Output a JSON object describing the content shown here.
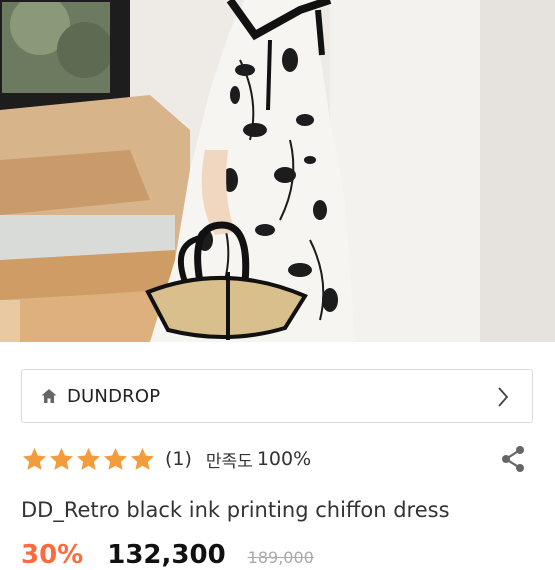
{
  "store": {
    "name": "DUNDROP",
    "home_icon": "home-icon",
    "arrow_icon": "chevron-right-icon"
  },
  "rating": {
    "stars": 5,
    "star_color": "#f39c3c",
    "review_count": "(1)",
    "satisfaction_label": "만족도",
    "satisfaction_value": "100%"
  },
  "share_icon": "share-icon",
  "product": {
    "title": "DD_Retro black ink printing chiffon dress"
  },
  "price": {
    "discount": "30%",
    "current": "132,300",
    "original": "189,000",
    "discount_color": "#ff6a3d"
  }
}
